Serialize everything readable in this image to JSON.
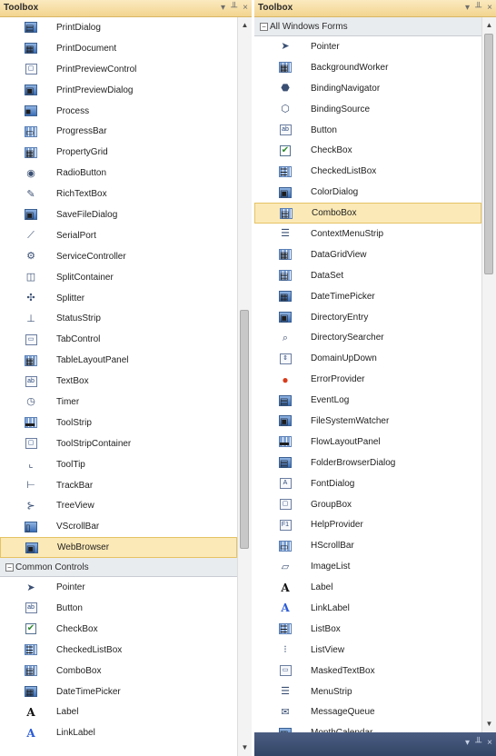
{
  "left": {
    "title": "Toolbox",
    "title_buttons": [
      "▾",
      "╨",
      "×"
    ],
    "items_top": [
      {
        "label": "PrintDialog",
        "icon": "print-dialog-icon",
        "glyph": "▤",
        "style": "blue"
      },
      {
        "label": "PrintDocument",
        "icon": "print-document-icon",
        "glyph": "▦",
        "style": "blue"
      },
      {
        "label": "PrintPreviewControl",
        "icon": "print-preview-control-icon",
        "glyph": "▢",
        "style": "box"
      },
      {
        "label": "PrintPreviewDialog",
        "icon": "print-preview-dialog-icon",
        "glyph": "▣",
        "style": "blue"
      },
      {
        "label": "Process",
        "icon": "process-icon",
        "glyph": "■",
        "style": "blue"
      },
      {
        "label": "ProgressBar",
        "icon": "progressbar-icon",
        "glyph": "▭",
        "style": "grid"
      },
      {
        "label": "PropertyGrid",
        "icon": "propertygrid-icon",
        "glyph": "▦",
        "style": "grid"
      },
      {
        "label": "RadioButton",
        "icon": "radiobutton-icon",
        "glyph": "◉",
        "style": "plain"
      },
      {
        "label": "RichTextBox",
        "icon": "richtextbox-icon",
        "glyph": "✎",
        "style": "plain"
      },
      {
        "label": "SaveFileDialog",
        "icon": "savefiledialog-icon",
        "glyph": "▣",
        "style": "blue"
      },
      {
        "label": "SerialPort",
        "icon": "serialport-icon",
        "glyph": "⟋",
        "style": "plain"
      },
      {
        "label": "ServiceController",
        "icon": "servicecontroller-icon",
        "glyph": "⚙",
        "style": "plain"
      },
      {
        "label": "SplitContainer",
        "icon": "splitcontainer-icon",
        "glyph": "◫",
        "style": "plain"
      },
      {
        "label": "Splitter",
        "icon": "splitter-icon",
        "glyph": "✣",
        "style": "plain"
      },
      {
        "label": "StatusStrip",
        "icon": "statusstrip-icon",
        "glyph": "⊥",
        "style": "plain"
      },
      {
        "label": "TabControl",
        "icon": "tabcontrol-icon",
        "glyph": "▭",
        "style": "box"
      },
      {
        "label": "TableLayoutPanel",
        "icon": "tablelayoutpanel-icon",
        "glyph": "▦",
        "style": "grid"
      },
      {
        "label": "TextBox",
        "icon": "textbox-icon",
        "glyph": "ab",
        "style": "box"
      },
      {
        "label": "Timer",
        "icon": "timer-icon",
        "glyph": "◷",
        "style": "plain"
      },
      {
        "label": "ToolStrip",
        "icon": "toolstrip-icon",
        "glyph": "▬",
        "style": "grid"
      },
      {
        "label": "ToolStripContainer",
        "icon": "toolstripcontainer-icon",
        "glyph": "▢",
        "style": "box"
      },
      {
        "label": "ToolTip",
        "icon": "tooltip-icon",
        "glyph": "⌞",
        "style": "plain"
      },
      {
        "label": "TrackBar",
        "icon": "trackbar-icon",
        "glyph": "⊢",
        "style": "plain"
      },
      {
        "label": "TreeView",
        "icon": "treeview-icon",
        "glyph": "⊱",
        "style": "plain"
      },
      {
        "label": "VScrollBar",
        "icon": "vscrollbar-icon",
        "glyph": "▯",
        "style": "blue"
      },
      {
        "label": "WebBrowser",
        "icon": "webbrowser-icon",
        "glyph": "▣",
        "style": "blue",
        "selected": true
      }
    ],
    "group": {
      "toggle": "⊟",
      "label": "Common Controls"
    },
    "items_bottom": [
      {
        "label": "Pointer",
        "icon": "pointer-icon",
        "glyph": "➤",
        "style": "plain"
      },
      {
        "label": "Button",
        "icon": "button-icon",
        "glyph": "ab",
        "style": "box"
      },
      {
        "label": "CheckBox",
        "icon": "checkbox-icon",
        "glyph": "✔",
        "style": "check"
      },
      {
        "label": "CheckedListBox",
        "icon": "checkedlistbox-icon",
        "glyph": "☰",
        "style": "grid"
      },
      {
        "label": "ComboBox",
        "icon": "combobox-icon",
        "glyph": "▤",
        "style": "grid"
      },
      {
        "label": "DateTimePicker",
        "icon": "datetimepicker-icon",
        "glyph": "▦",
        "style": "blue"
      },
      {
        "label": "Label",
        "icon": "label-icon",
        "glyph": "A",
        "style": "text"
      },
      {
        "label": "LinkLabel",
        "icon": "linklabel-icon",
        "glyph": "A",
        "style": "linktext"
      }
    ]
  },
  "right": {
    "title": "Toolbox",
    "title_buttons": [
      "▾",
      "╨",
      "×"
    ],
    "group": {
      "toggle": "⊟",
      "label": "All Windows Forms"
    },
    "items": [
      {
        "label": "Pointer",
        "icon": "pointer-icon",
        "glyph": "➤",
        "style": "plain"
      },
      {
        "label": "BackgroundWorker",
        "icon": "backgroundworker-icon",
        "glyph": "▦",
        "style": "grid"
      },
      {
        "label": "BindingNavigator",
        "icon": "bindingnavigator-icon",
        "glyph": "⬣",
        "style": "plain"
      },
      {
        "label": "BindingSource",
        "icon": "bindingsource-icon",
        "glyph": "⬡",
        "style": "plain"
      },
      {
        "label": "Button",
        "icon": "button-icon",
        "glyph": "ab",
        "style": "box"
      },
      {
        "label": "CheckBox",
        "icon": "checkbox-icon",
        "glyph": "✔",
        "style": "check"
      },
      {
        "label": "CheckedListBox",
        "icon": "checkedlistbox-icon",
        "glyph": "☰",
        "style": "grid"
      },
      {
        "label": "ColorDialog",
        "icon": "colordialog-icon",
        "glyph": "▣",
        "style": "blue"
      },
      {
        "label": "ComboBox",
        "icon": "combobox-icon",
        "glyph": "▤",
        "style": "grid",
        "selected": true
      },
      {
        "label": "ContextMenuStrip",
        "icon": "contextmenustrip-icon",
        "glyph": "☰",
        "style": "plain"
      },
      {
        "label": "DataGridView",
        "icon": "datagridview-icon",
        "glyph": "▦",
        "style": "grid"
      },
      {
        "label": "DataSet",
        "icon": "dataset-icon",
        "glyph": "▤",
        "style": "grid"
      },
      {
        "label": "DateTimePicker",
        "icon": "datetimepicker-icon",
        "glyph": "▦",
        "style": "blue"
      },
      {
        "label": "DirectoryEntry",
        "icon": "directoryentry-icon",
        "glyph": "▣",
        "style": "blue"
      },
      {
        "label": "DirectorySearcher",
        "icon": "directorysearcher-icon",
        "glyph": "⌕",
        "style": "plain"
      },
      {
        "label": "DomainUpDown",
        "icon": "domainupdown-icon",
        "glyph": "⇕",
        "style": "box"
      },
      {
        "label": "ErrorProvider",
        "icon": "errorprovider-icon",
        "glyph": "●",
        "style": "error"
      },
      {
        "label": "EventLog",
        "icon": "eventlog-icon",
        "glyph": "▤",
        "style": "blue"
      },
      {
        "label": "FileSystemWatcher",
        "icon": "filesystemwatcher-icon",
        "glyph": "▣",
        "style": "blue"
      },
      {
        "label": "FlowLayoutPanel",
        "icon": "flowlayoutpanel-icon",
        "glyph": "▬",
        "style": "grid"
      },
      {
        "label": "FolderBrowserDialog",
        "icon": "folderbrowserdialog-icon",
        "glyph": "▤",
        "style": "blue"
      },
      {
        "label": "FontDialog",
        "icon": "fontdialog-icon",
        "glyph": "A",
        "style": "box"
      },
      {
        "label": "GroupBox",
        "icon": "groupbox-icon",
        "glyph": "▢",
        "style": "box"
      },
      {
        "label": "HelpProvider",
        "icon": "helpprovider-icon",
        "glyph": "F1",
        "style": "box"
      },
      {
        "label": "HScrollBar",
        "icon": "hscrollbar-icon",
        "glyph": "▭",
        "style": "grid"
      },
      {
        "label": "ImageList",
        "icon": "imagelist-icon",
        "glyph": "▱",
        "style": "plain"
      },
      {
        "label": "Label",
        "icon": "label-icon",
        "glyph": "A",
        "style": "text"
      },
      {
        "label": "LinkLabel",
        "icon": "linklabel-icon",
        "glyph": "A",
        "style": "linktext"
      },
      {
        "label": "ListBox",
        "icon": "listbox-icon",
        "glyph": "☰",
        "style": "grid"
      },
      {
        "label": "ListView",
        "icon": "listview-icon",
        "glyph": "⁝",
        "style": "plain"
      },
      {
        "label": "MaskedTextBox",
        "icon": "maskedtextbox-icon",
        "glyph": "▭",
        "style": "box"
      },
      {
        "label": "MenuStrip",
        "icon": "menustrip-icon",
        "glyph": "☰",
        "style": "plain"
      },
      {
        "label": "MessageQueue",
        "icon": "messagequeue-icon",
        "glyph": "✉",
        "style": "plain"
      },
      {
        "label": "MonthCalendar",
        "icon": "monthcalendar-icon",
        "glyph": "▦",
        "style": "blue"
      }
    ],
    "bottom_buttons": [
      "▾",
      "╨",
      "×"
    ]
  }
}
